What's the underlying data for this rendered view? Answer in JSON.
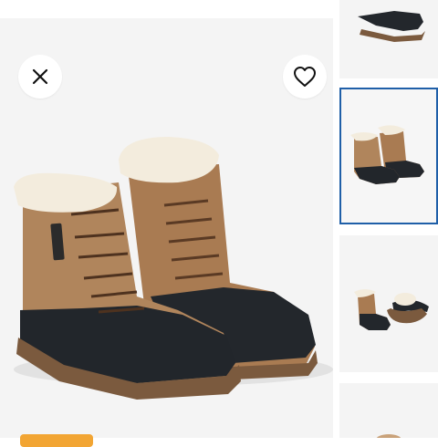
{
  "colors": {
    "background": "#ffffff",
    "image_background": "#f4f4f4",
    "selected_outline": "#1f5fa8",
    "promo_badge": "#f2a533",
    "boot_leather": "#a97b52",
    "boot_rubber": "#22262b",
    "boot_sole": "#7b5a3e",
    "fur": "#f3ecdd"
  },
  "icons": {
    "close": "close-icon",
    "favorite": "heart-outline-icon"
  },
  "thumbnails": [
    {
      "id": "boots-top-cropped",
      "selected": false
    },
    {
      "id": "boots-pair-side",
      "selected": true
    },
    {
      "id": "boots-with-sole-view",
      "selected": false
    },
    {
      "id": "boots-partial",
      "selected": false
    }
  ]
}
